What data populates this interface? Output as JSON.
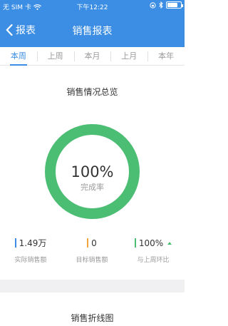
{
  "status_bar": {
    "carrier": "无 SIM 卡",
    "time": "下午12:22",
    "battery_level": 0.8
  },
  "navbar": {
    "back_label": "报表",
    "title": "销售报表"
  },
  "tabs": [
    {
      "label": "本周",
      "active": true
    },
    {
      "label": "上周",
      "active": false
    },
    {
      "label": "本月",
      "active": false
    },
    {
      "label": "上月",
      "active": false
    },
    {
      "label": "本年",
      "active": false
    }
  ],
  "overview": {
    "title": "销售情况总览",
    "completion_percent": "100%",
    "completion_value": 1.0,
    "completion_label": "完成率",
    "ring_color": "#4cbe73"
  },
  "stats": [
    {
      "value": "1.49万",
      "label": "实际销售额",
      "color": "#3b8ee4"
    },
    {
      "value": "0",
      "label": "目标销售额",
      "color": "#f0a63c"
    },
    {
      "value": "100%",
      "label": "与上周环比",
      "color": "#4cbe73",
      "trend": "up"
    }
  ],
  "line_chart": {
    "title": "销售折线图"
  },
  "colors": {
    "accent": "#3b8ee4",
    "success": "#4cbe73"
  }
}
